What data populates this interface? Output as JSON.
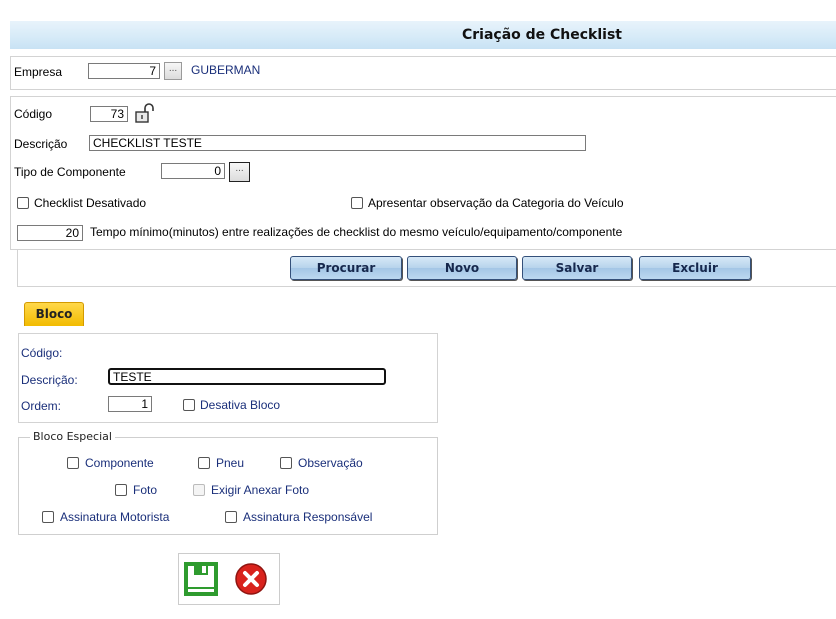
{
  "title": "Criação de Checklist",
  "empresa": {
    "label": "Empresa",
    "value": "7",
    "name": "GUBERMAN"
  },
  "codigo": {
    "label": "Código",
    "value": "73"
  },
  "descricao": {
    "label": "Descrição",
    "value": "CHECKLIST TESTE"
  },
  "tipo_componente": {
    "label": "Tipo de Componente",
    "value": "0"
  },
  "checklist_desativado": {
    "label": "Checklist Desativado",
    "checked": false
  },
  "apresentar_obs": {
    "label": "Apresentar observação da Categoria do Veículo",
    "checked": false
  },
  "tempo_minimo": {
    "value": "20",
    "label": "Tempo mínimo(minutos) entre realizações de checklist do mesmo veículo/equipamento/componente"
  },
  "buttons": {
    "procurar": "Procurar",
    "novo": "Novo",
    "salvar": "Salvar",
    "excluir": "Excluir"
  },
  "bloco_tab": "Bloco",
  "bloco": {
    "codigo_label": "Código:",
    "descricao_label": "Descrição:",
    "descricao_value": "TESTE",
    "ordem_label": "Ordem:",
    "ordem_value": "1",
    "desativa_label": "Desativa Bloco"
  },
  "bloco_especial": {
    "legend": "Bloco Especial",
    "componente": "Componente",
    "pneu": "Pneu",
    "observacao": "Observação",
    "foto": "Foto",
    "exigir_anexar_foto": "Exigir Anexar Foto",
    "assinatura_motorista": "Assinatura Motorista",
    "assinatura_responsavel": "Assinatura Responsável"
  },
  "icons": {
    "save": "save-icon",
    "cancel": "cancel-icon",
    "lock": "unlock-icon"
  },
  "colors": {
    "tab_accent": "#f2bb00",
    "title_bg": "#d7ebf8",
    "button_bg": "#b7d3ec",
    "cancel_red": "#d9231d",
    "save_green": "#2e9b2e"
  }
}
